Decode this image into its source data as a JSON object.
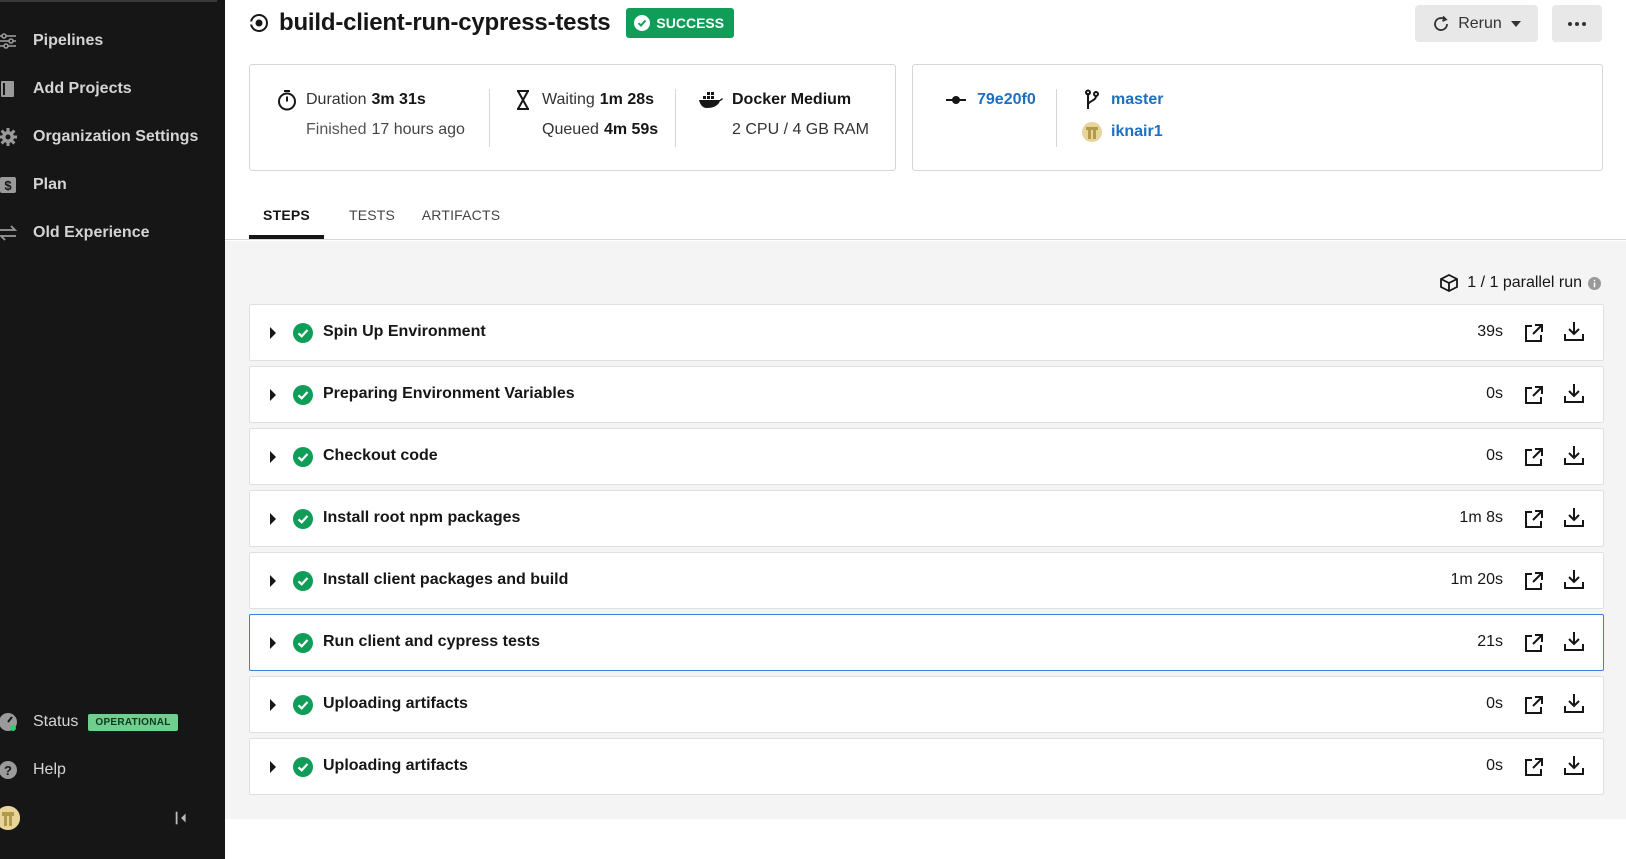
{
  "sidebar": {
    "items": [
      {
        "label": "Pipelines",
        "icon": "pipelines-icon"
      },
      {
        "label": "Add Projects",
        "icon": "book-icon"
      },
      {
        "label": "Organization Settings",
        "icon": "gear-icon"
      },
      {
        "label": "Plan",
        "icon": "dollar-icon"
      },
      {
        "label": "Old Experience",
        "icon": "swap-icon"
      }
    ],
    "status_label": "Status",
    "status_badge": "OPERATIONAL",
    "help_label": "Help"
  },
  "header": {
    "job_title": "build-client-run-cypress-tests",
    "status_badge": "SUCCESS",
    "rerun_label": "Rerun"
  },
  "summary": {
    "duration_label": "Duration",
    "duration_value": "3m 31s",
    "finished_label": "Finished",
    "finished_value": "17 hours ago",
    "waiting_label": "Waiting",
    "waiting_value": "1m 28s",
    "queued_label": "Queued",
    "queued_value": "4m 59s",
    "executor": "Docker Medium",
    "resources": "2 CPU / 4 GB RAM"
  },
  "commit": {
    "sha": "79e20f0",
    "branch": "master",
    "user": "iknair1"
  },
  "tabs": [
    {
      "label": "STEPS",
      "active": true
    },
    {
      "label": "TESTS",
      "active": false
    },
    {
      "label": "ARTIFACTS",
      "active": false
    }
  ],
  "parallel_runs": "1 / 1 parallel run",
  "steps": [
    {
      "name": "Spin Up Environment",
      "duration": "39s"
    },
    {
      "name": "Preparing Environment Variables",
      "duration": "0s"
    },
    {
      "name": "Checkout code",
      "duration": "0s"
    },
    {
      "name": "Install root npm packages",
      "duration": "1m 8s"
    },
    {
      "name": "Install client packages and build",
      "duration": "1m 20s"
    },
    {
      "name": "Run client and cypress tests",
      "duration": "21s"
    },
    {
      "name": "Uploading artifacts",
      "duration": "0s"
    },
    {
      "name": "Uploading artifacts",
      "duration": "0s"
    }
  ],
  "colors": {
    "sidebar_bg": "#161616",
    "success": "#0f9d58",
    "link": "#1f6fbf",
    "selected_border": "#3b82d6"
  }
}
